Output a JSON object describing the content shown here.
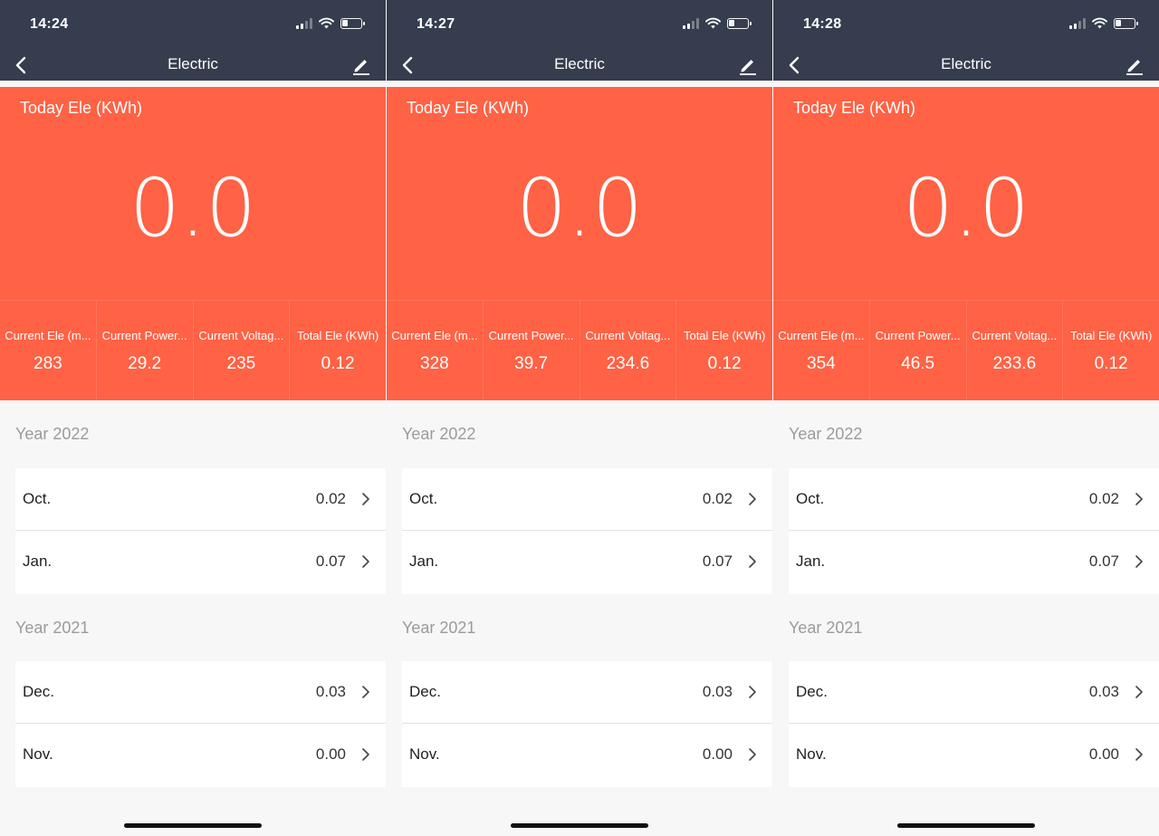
{
  "colors": {
    "topbar": "#353d4e",
    "hero": "#ff6245",
    "year_label": "#9b9b9b",
    "background": "#f7f7f7"
  },
  "screens": [
    {
      "status_time": "14:24",
      "nav_title": "Electric",
      "battery_level": 0.3,
      "today_title": "Today Ele (KWh)",
      "today_value": "0.0",
      "stats": [
        {
          "label": "Current Ele (m...",
          "value": "283"
        },
        {
          "label": "Current Power...",
          "value": "29.2"
        },
        {
          "label": "Current Voltag...",
          "value": "235"
        },
        {
          "label": "Total Ele (KWh)",
          "value": "0.12"
        }
      ],
      "years": [
        {
          "year": "Year 2022",
          "months": [
            {
              "name": "Oct.",
              "value": "0.02"
            },
            {
              "name": "Jan.",
              "value": "0.07"
            }
          ]
        },
        {
          "year": "Year 2021",
          "months": [
            {
              "name": "Dec.",
              "value": "0.03"
            },
            {
              "name": "Nov.",
              "value": "0.00"
            }
          ]
        }
      ]
    },
    {
      "status_time": "14:27",
      "nav_title": "Electric",
      "battery_level": 0.3,
      "today_title": "Today Ele (KWh)",
      "today_value": "0.0",
      "stats": [
        {
          "label": "Current Ele (m...",
          "value": "328"
        },
        {
          "label": "Current Power...",
          "value": "39.7"
        },
        {
          "label": "Current Voltag...",
          "value": "234.6"
        },
        {
          "label": "Total Ele (KWh)",
          "value": "0.12"
        }
      ],
      "years": [
        {
          "year": "Year 2022",
          "months": [
            {
              "name": "Oct.",
              "value": "0.02"
            },
            {
              "name": "Jan.",
              "value": "0.07"
            }
          ]
        },
        {
          "year": "Year 2021",
          "months": [
            {
              "name": "Dec.",
              "value": "0.03"
            },
            {
              "name": "Nov.",
              "value": "0.00"
            }
          ]
        }
      ]
    },
    {
      "status_time": "14:28",
      "nav_title": "Electric",
      "battery_level": 0.3,
      "today_title": "Today Ele (KWh)",
      "today_value": "0.0",
      "stats": [
        {
          "label": "Current Ele (m...",
          "value": "354"
        },
        {
          "label": "Current Power...",
          "value": "46.5"
        },
        {
          "label": "Current Voltag...",
          "value": "233.6"
        },
        {
          "label": "Total Ele (KWh)",
          "value": "0.12"
        }
      ],
      "years": [
        {
          "year": "Year 2022",
          "months": [
            {
              "name": "Oct.",
              "value": "0.02"
            },
            {
              "name": "Jan.",
              "value": "0.07"
            }
          ]
        },
        {
          "year": "Year 2021",
          "months": [
            {
              "name": "Dec.",
              "value": "0.03"
            },
            {
              "name": "Nov.",
              "value": "0.00"
            }
          ]
        }
      ]
    }
  ]
}
